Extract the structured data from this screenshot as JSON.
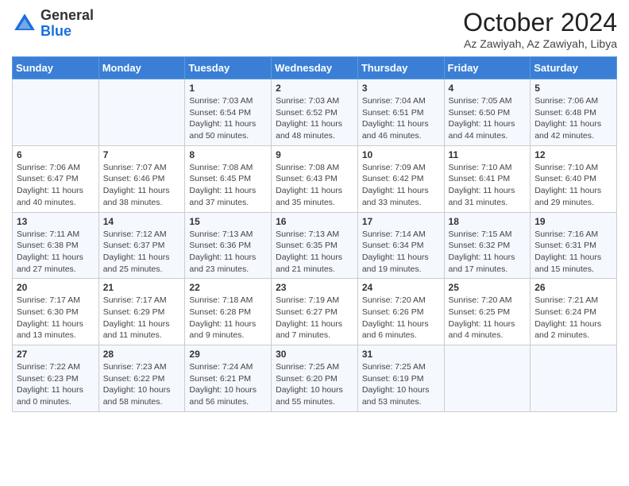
{
  "header": {
    "logo_general": "General",
    "logo_blue": "Blue",
    "month_title": "October 2024",
    "subtitle": "Az Zawiyah, Az Zawiyah, Libya"
  },
  "weekdays": [
    "Sunday",
    "Monday",
    "Tuesday",
    "Wednesday",
    "Thursday",
    "Friday",
    "Saturday"
  ],
  "weeks": [
    [
      {
        "day": "",
        "info": ""
      },
      {
        "day": "",
        "info": ""
      },
      {
        "day": "1",
        "info": "Sunrise: 7:03 AM\nSunset: 6:54 PM\nDaylight: 11 hours and 50 minutes."
      },
      {
        "day": "2",
        "info": "Sunrise: 7:03 AM\nSunset: 6:52 PM\nDaylight: 11 hours and 48 minutes."
      },
      {
        "day": "3",
        "info": "Sunrise: 7:04 AM\nSunset: 6:51 PM\nDaylight: 11 hours and 46 minutes."
      },
      {
        "day": "4",
        "info": "Sunrise: 7:05 AM\nSunset: 6:50 PM\nDaylight: 11 hours and 44 minutes."
      },
      {
        "day": "5",
        "info": "Sunrise: 7:06 AM\nSunset: 6:48 PM\nDaylight: 11 hours and 42 minutes."
      }
    ],
    [
      {
        "day": "6",
        "info": "Sunrise: 7:06 AM\nSunset: 6:47 PM\nDaylight: 11 hours and 40 minutes."
      },
      {
        "day": "7",
        "info": "Sunrise: 7:07 AM\nSunset: 6:46 PM\nDaylight: 11 hours and 38 minutes."
      },
      {
        "day": "8",
        "info": "Sunrise: 7:08 AM\nSunset: 6:45 PM\nDaylight: 11 hours and 37 minutes."
      },
      {
        "day": "9",
        "info": "Sunrise: 7:08 AM\nSunset: 6:43 PM\nDaylight: 11 hours and 35 minutes."
      },
      {
        "day": "10",
        "info": "Sunrise: 7:09 AM\nSunset: 6:42 PM\nDaylight: 11 hours and 33 minutes."
      },
      {
        "day": "11",
        "info": "Sunrise: 7:10 AM\nSunset: 6:41 PM\nDaylight: 11 hours and 31 minutes."
      },
      {
        "day": "12",
        "info": "Sunrise: 7:10 AM\nSunset: 6:40 PM\nDaylight: 11 hours and 29 minutes."
      }
    ],
    [
      {
        "day": "13",
        "info": "Sunrise: 7:11 AM\nSunset: 6:38 PM\nDaylight: 11 hours and 27 minutes."
      },
      {
        "day": "14",
        "info": "Sunrise: 7:12 AM\nSunset: 6:37 PM\nDaylight: 11 hours and 25 minutes."
      },
      {
        "day": "15",
        "info": "Sunrise: 7:13 AM\nSunset: 6:36 PM\nDaylight: 11 hours and 23 minutes."
      },
      {
        "day": "16",
        "info": "Sunrise: 7:13 AM\nSunset: 6:35 PM\nDaylight: 11 hours and 21 minutes."
      },
      {
        "day": "17",
        "info": "Sunrise: 7:14 AM\nSunset: 6:34 PM\nDaylight: 11 hours and 19 minutes."
      },
      {
        "day": "18",
        "info": "Sunrise: 7:15 AM\nSunset: 6:32 PM\nDaylight: 11 hours and 17 minutes."
      },
      {
        "day": "19",
        "info": "Sunrise: 7:16 AM\nSunset: 6:31 PM\nDaylight: 11 hours and 15 minutes."
      }
    ],
    [
      {
        "day": "20",
        "info": "Sunrise: 7:17 AM\nSunset: 6:30 PM\nDaylight: 11 hours and 13 minutes."
      },
      {
        "day": "21",
        "info": "Sunrise: 7:17 AM\nSunset: 6:29 PM\nDaylight: 11 hours and 11 minutes."
      },
      {
        "day": "22",
        "info": "Sunrise: 7:18 AM\nSunset: 6:28 PM\nDaylight: 11 hours and 9 minutes."
      },
      {
        "day": "23",
        "info": "Sunrise: 7:19 AM\nSunset: 6:27 PM\nDaylight: 11 hours and 7 minutes."
      },
      {
        "day": "24",
        "info": "Sunrise: 7:20 AM\nSunset: 6:26 PM\nDaylight: 11 hours and 6 minutes."
      },
      {
        "day": "25",
        "info": "Sunrise: 7:20 AM\nSunset: 6:25 PM\nDaylight: 11 hours and 4 minutes."
      },
      {
        "day": "26",
        "info": "Sunrise: 7:21 AM\nSunset: 6:24 PM\nDaylight: 11 hours and 2 minutes."
      }
    ],
    [
      {
        "day": "27",
        "info": "Sunrise: 7:22 AM\nSunset: 6:23 PM\nDaylight: 11 hours and 0 minutes."
      },
      {
        "day": "28",
        "info": "Sunrise: 7:23 AM\nSunset: 6:22 PM\nDaylight: 10 hours and 58 minutes."
      },
      {
        "day": "29",
        "info": "Sunrise: 7:24 AM\nSunset: 6:21 PM\nDaylight: 10 hours and 56 minutes."
      },
      {
        "day": "30",
        "info": "Sunrise: 7:25 AM\nSunset: 6:20 PM\nDaylight: 10 hours and 55 minutes."
      },
      {
        "day": "31",
        "info": "Sunrise: 7:25 AM\nSunset: 6:19 PM\nDaylight: 10 hours and 53 minutes."
      },
      {
        "day": "",
        "info": ""
      },
      {
        "day": "",
        "info": ""
      }
    ]
  ]
}
